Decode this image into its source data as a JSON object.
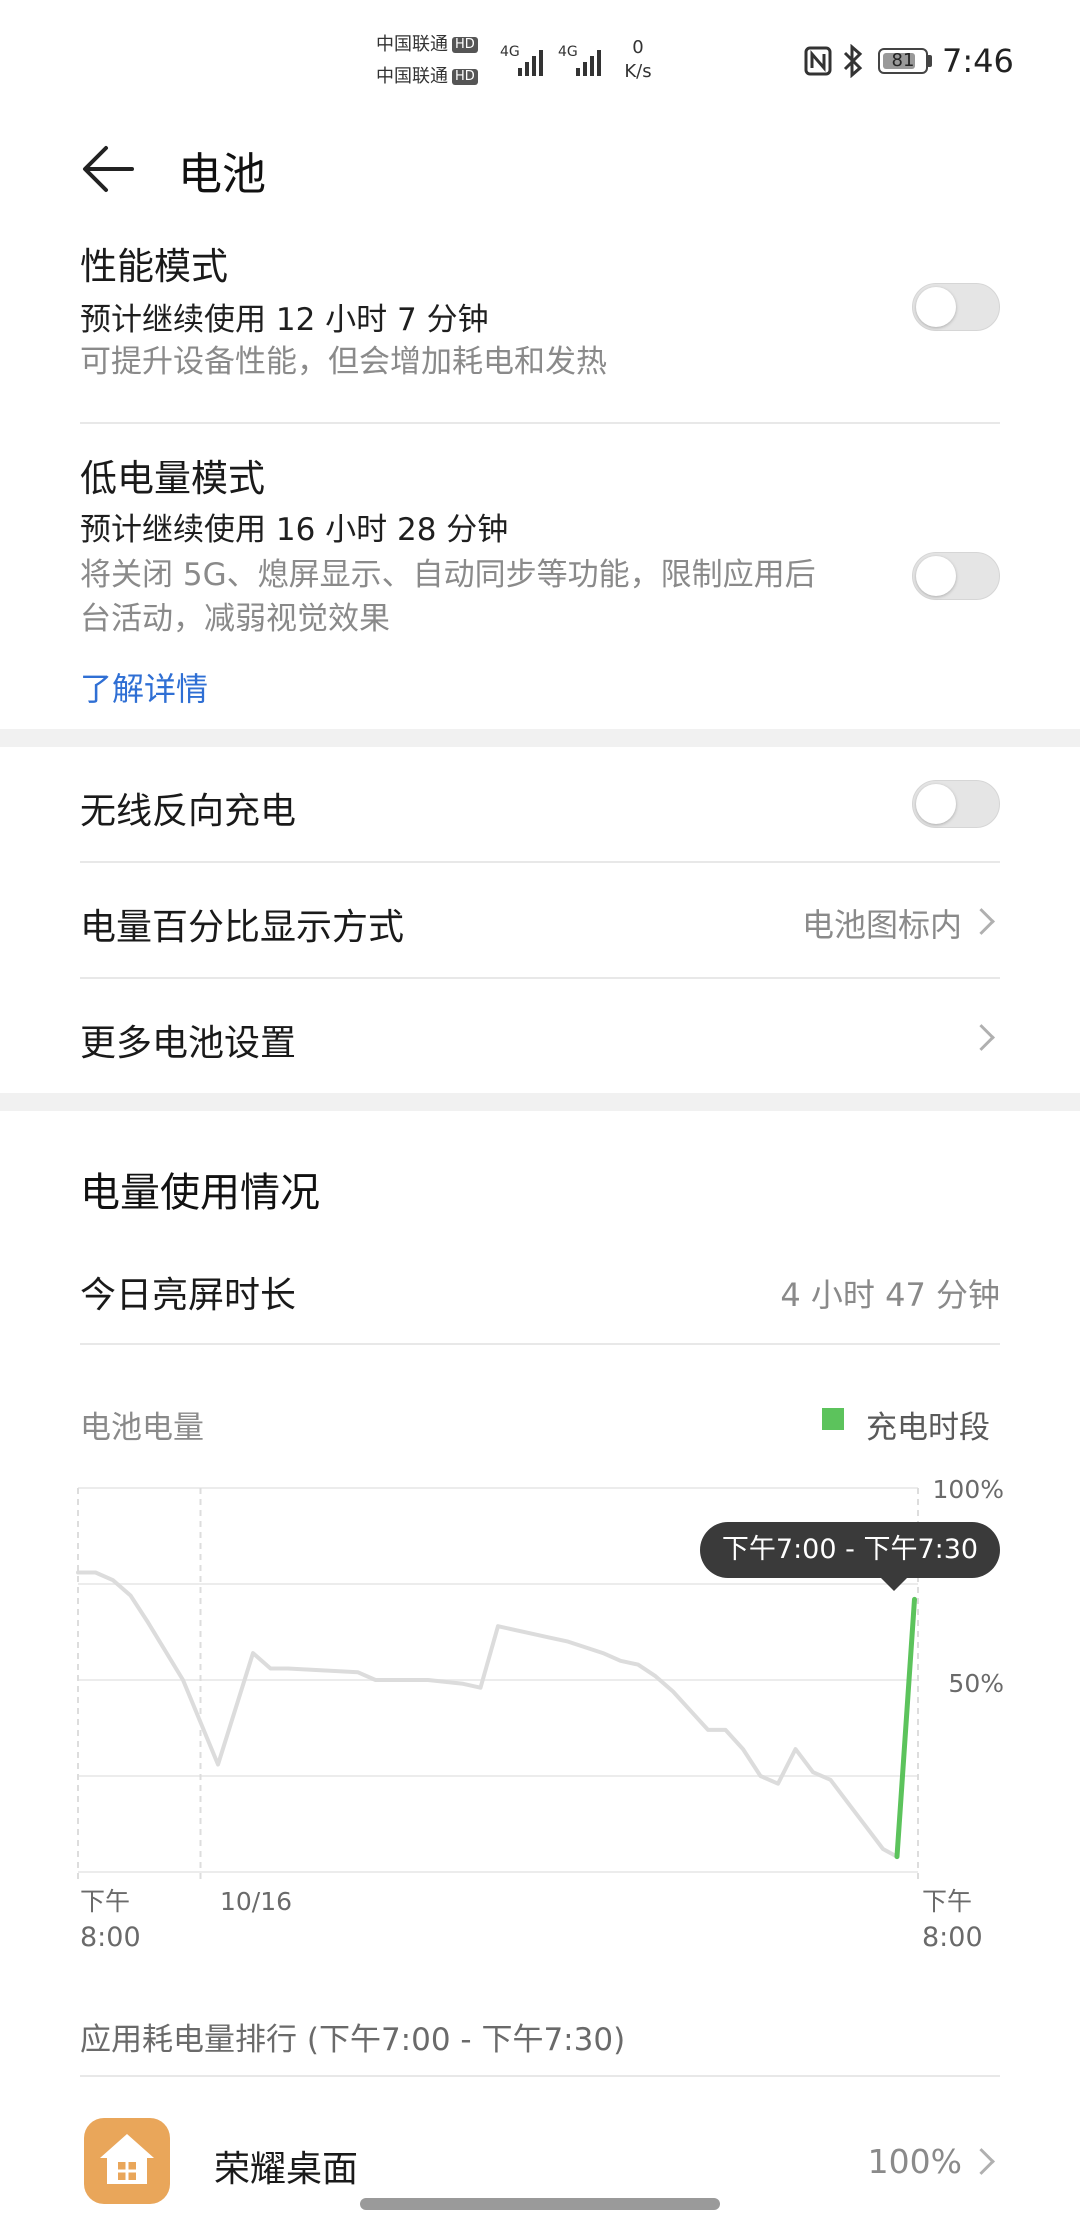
{
  "status_bar": {
    "carrier1": "中国联通",
    "carrier2": "中国联通",
    "hd": "HD",
    "net1": "4G",
    "net2": "4G",
    "speed_value": "0",
    "speed_unit": "K/s",
    "battery_level": "81",
    "battery_fraction": 0.81,
    "time": "7:46"
  },
  "header": {
    "title": "电池"
  },
  "performance_mode": {
    "title": "性能模式",
    "estimate": "预计继续使用 12 小时 7 分钟",
    "description": "可提升设备性能，但会增加耗电和发热",
    "enabled": false
  },
  "low_power_mode": {
    "title": "低电量模式",
    "estimate": "预计继续使用 16 小时 28 分钟",
    "description_line1": "将关闭 5G、熄屏显示、自动同步等功能，限制应用后",
    "description_line2": "台活动，减弱视觉效果",
    "learn_more": "了解详情",
    "enabled": false
  },
  "settings": {
    "reverse_charging": {
      "label": "无线反向充电",
      "enabled": false
    },
    "percentage_display": {
      "label": "电量百分比显示方式",
      "value": "电池图标内"
    },
    "more_settings": {
      "label": "更多电池设置"
    }
  },
  "usage": {
    "section_title": "电量使用情况",
    "screen_time_label": "今日亮屏时长",
    "screen_time_value": "4 小时 47 分钟",
    "chart_label": "电池电量",
    "legend": "充电时段",
    "ranking_title": "应用耗电量排行 (下午7:00 - 下午7:30)"
  },
  "chart_data": {
    "type": "line",
    "title": "",
    "ylabel": "",
    "ylim": [
      0,
      100
    ],
    "y_ticks": [
      "100%",
      "50%"
    ],
    "x_ticks": [
      {
        "top": "下午",
        "bottom": "8:00"
      },
      {
        "top": "10/16",
        "bottom": ""
      },
      {
        "top": "下午",
        "bottom": "8:00"
      }
    ],
    "tooltip": "下午7:00 - 下午7:30",
    "series": [
      {
        "name": "",
        "color": "#dcdcdc",
        "x": [
          0,
          0.5,
          1,
          1.5,
          2,
          3,
          4,
          5,
          5.5,
          6,
          8,
          8.5,
          10,
          11,
          11.5,
          12,
          13,
          13.5,
          14,
          15,
          15.5,
          16,
          16.5,
          17,
          17.5,
          18,
          18.5,
          19,
          19.5,
          20,
          20.5,
          21,
          21.5,
          22,
          22.5,
          23,
          23.4
        ],
        "y": [
          78,
          78,
          76,
          72,
          65,
          50,
          28,
          57,
          53,
          53,
          52,
          50,
          50,
          49,
          48,
          64,
          62,
          61,
          60,
          57,
          55,
          54,
          51,
          47,
          42,
          37,
          37,
          32,
          25,
          23,
          32,
          26,
          24,
          18,
          12,
          6,
          4
        ]
      },
      {
        "name": "充电时段",
        "color": "#5cc35c",
        "x": [
          23.4,
          23.9
        ],
        "y": [
          4,
          71
        ]
      }
    ],
    "x_range": [
      0,
      24
    ],
    "grid": true
  },
  "apps": [
    {
      "name": "荣耀桌面",
      "percent": "100%"
    }
  ]
}
